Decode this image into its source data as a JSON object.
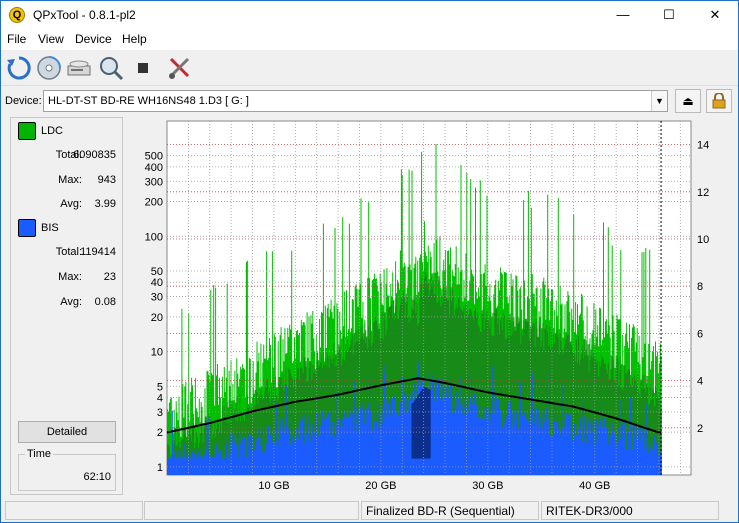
{
  "window": {
    "title": "QPxTool - 0.8.1-pl2",
    "app_icon_letter": "Q",
    "controls": {
      "minimize": "—",
      "maximize": "☐",
      "close": "✕"
    }
  },
  "menu": {
    "items": [
      "File",
      "View",
      "Device",
      "Help"
    ]
  },
  "toolbar": {
    "icons": [
      "refresh-icon",
      "disc-info-icon",
      "drive-icon",
      "scan-icon",
      "stop-icon",
      "tools-icon"
    ]
  },
  "device": {
    "label": "Device:",
    "selected": "HL-DT-ST BD-RE  WH16NS48  1.D3 [ G: ]",
    "eject_icon": "⏏",
    "lock_icon": "🔒"
  },
  "stats": {
    "ldc": {
      "name": "LDC",
      "color": "#00b400",
      "total_label": "Total:",
      "total": "6090835",
      "max_label": "Max:",
      "max": "943",
      "avg_label": "Avg:",
      "avg": "3.99"
    },
    "bis": {
      "name": "BIS",
      "color": "#1a5cff",
      "total_label": "Total:",
      "total": "119414",
      "max_label": "Max:",
      "max": "23",
      "avg_label": "Avg:",
      "avg": "0.08"
    },
    "detailed_button": "Detailed",
    "time_label": "Time",
    "time_value": "62:10"
  },
  "chart_data": {
    "type": "line",
    "x_ticks": [
      "10 GB",
      "20 GB",
      "30 GB",
      "40 GB"
    ],
    "x_tick_values": [
      10,
      20,
      30,
      40
    ],
    "xlim": [
      0,
      49
    ],
    "left_axis_scale": "log",
    "left_ticks": [
      "1",
      "2",
      "3",
      "4",
      "5",
      "10",
      "20",
      "30",
      "40",
      "50",
      "100",
      "200",
      "300",
      "400",
      "500"
    ],
    "left_tick_values": [
      1,
      2,
      3,
      4,
      5,
      10,
      20,
      30,
      40,
      50,
      100,
      200,
      300,
      400,
      500
    ],
    "ylim_left": [
      0.85,
      1000
    ],
    "right_ticks": [
      "2",
      "4",
      "6",
      "8",
      "10",
      "12",
      "14"
    ],
    "right_tick_values": [
      2,
      4,
      6,
      8,
      10,
      12,
      14
    ],
    "ylim_right": [
      0,
      15
    ],
    "data_end_x": 46.2,
    "grid": true,
    "series": [
      {
        "name": "LDC",
        "color": "#00c000",
        "x": [
          0,
          2,
          4,
          6,
          8,
          10,
          12,
          14,
          16,
          18,
          20,
          22,
          23.5,
          24,
          26,
          28,
          30,
          32,
          34,
          36,
          38,
          40,
          42,
          44,
          46
        ],
        "values": [
          4,
          5,
          6,
          8,
          10,
          13,
          17,
          20,
          26,
          34,
          45,
          70,
          60,
          120,
          80,
          60,
          50,
          45,
          40,
          35,
          30,
          22,
          18,
          15,
          10
        ]
      },
      {
        "name": "BIS",
        "color": "#1a5cff",
        "x": [
          0,
          4,
          8,
          12,
          16,
          20,
          23,
          24,
          28,
          32,
          36,
          40,
          44,
          46
        ],
        "values": [
          1.2,
          1.3,
          1.8,
          2.2,
          2.6,
          3.0,
          4.0,
          5.5,
          3.5,
          3.0,
          2.6,
          2.2,
          1.8,
          1.4
        ]
      },
      {
        "name": "Speed",
        "color": "#000000",
        "x": [
          0,
          4,
          8,
          12,
          16,
          20,
          23.5,
          26,
          30,
          34,
          38,
          42,
          46
        ],
        "values_right": [
          1.8,
          2.2,
          2.7,
          3.1,
          3.4,
          3.8,
          4.1,
          3.9,
          3.5,
          3.2,
          2.9,
          2.4,
          1.8
        ]
      }
    ]
  },
  "status": {
    "disc_type": "Finalized BD-R (Sequential)",
    "media_id": "RITEK-DR3/000"
  }
}
